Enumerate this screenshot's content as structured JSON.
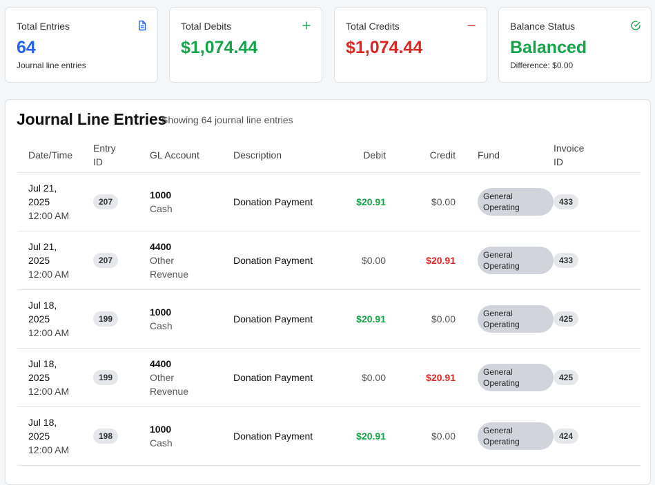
{
  "summary": {
    "total_entries": {
      "title": "Total Entries",
      "value": "64",
      "sub": "Journal line entries",
      "icon": "document-icon",
      "color": "#2563eb"
    },
    "total_debits": {
      "title": "Total Debits",
      "value": "$1,074.44",
      "icon": "plus-icon",
      "color": "#16a34a"
    },
    "total_credits": {
      "title": "Total Credits",
      "value": "$1,074.44",
      "icon": "minus-icon",
      "color": "#dc2626"
    },
    "balance_status": {
      "title": "Balance Status",
      "value": "Balanced",
      "sub": "Difference: $0.00",
      "icon": "check-circle-icon",
      "color": "#16a34a"
    }
  },
  "journal": {
    "title": "Journal Line Entries",
    "subtitle": "Showing 64 journal line entries",
    "columns": {
      "date": "Date/Time",
      "entry_id": "Entry ID",
      "gl_account": "GL Account",
      "description": "Description",
      "debit": "Debit",
      "credit": "Credit",
      "fund": "Fund",
      "invoice_id": "Invoice ID"
    },
    "rows": [
      {
        "date": "Jul 21, 2025",
        "time": "12:00 AM",
        "entry_id": "207",
        "acct_num": "1000",
        "acct_name": "Cash",
        "description": "Donation Payment",
        "debit": "$20.91",
        "credit": "$0.00",
        "fund": "General Operating",
        "invoice_id": "433"
      },
      {
        "date": "Jul 21, 2025",
        "time": "12:00 AM",
        "entry_id": "207",
        "acct_num": "4400",
        "acct_name": "Other Revenue",
        "description": "Donation Payment",
        "debit": "$0.00",
        "credit": "$20.91",
        "fund": "General Operating",
        "invoice_id": "433"
      },
      {
        "date": "Jul 18, 2025",
        "time": "12:00 AM",
        "entry_id": "199",
        "acct_num": "1000",
        "acct_name": "Cash",
        "description": "Donation Payment",
        "debit": "$20.91",
        "credit": "$0.00",
        "fund": "General Operating",
        "invoice_id": "425"
      },
      {
        "date": "Jul 18, 2025",
        "time": "12:00 AM",
        "entry_id": "199",
        "acct_num": "4400",
        "acct_name": "Other Revenue",
        "description": "Donation Payment",
        "debit": "$0.00",
        "credit": "$20.91",
        "fund": "General Operating",
        "invoice_id": "425"
      },
      {
        "date": "Jul 18, 2025",
        "time": "12:00 AM",
        "entry_id": "198",
        "acct_num": "1000",
        "acct_name": "Cash",
        "description": "Donation Payment",
        "debit": "$20.91",
        "credit": "$0.00",
        "fund": "General Operating",
        "invoice_id": "424"
      }
    ]
  }
}
